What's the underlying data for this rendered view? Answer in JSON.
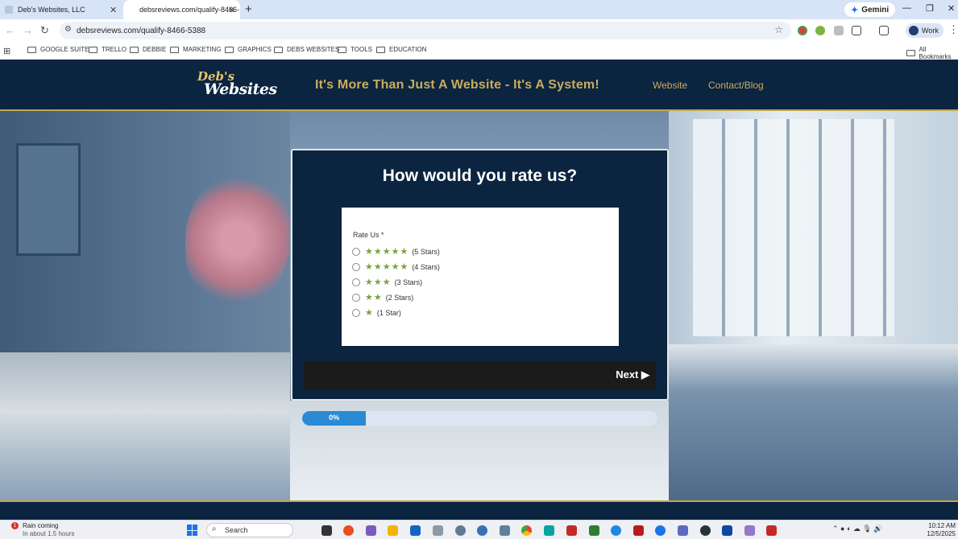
{
  "browser": {
    "tabs": [
      {
        "label": "Deb's Websites, LLC",
        "active": false
      },
      {
        "label": "debsreviews.com/qualify-8466-",
        "active": true
      }
    ],
    "gemini_label": "Gemini",
    "url": "debsreviews.com/qualify-8466-5388",
    "profile_label": "Work",
    "bookmarks": [
      "GOOGLE SUITE",
      "TRELLO",
      "DEBBIE",
      "MARKETING",
      "GRAPHICS",
      "DEBS WEBSITES",
      "TOOLS",
      "EDUCATION"
    ],
    "all_bookmarks_label": "All Bookmarks"
  },
  "site": {
    "logo_line1": "Deb's",
    "logo_line2": "Websites",
    "tagline": "It's More Than Just A Website - It's A System!",
    "nav": [
      "Website",
      "Contact/Blog"
    ]
  },
  "form": {
    "title": "How would you rate us?",
    "field_label": "Rate Us *",
    "options": [
      {
        "stars": "★★★★★",
        "label": "(5 Stars)"
      },
      {
        "stars": "★★★★★",
        "label": "(4 Stars)"
      },
      {
        "stars": "★★★",
        "label": "(3 Stars)"
      },
      {
        "stars": "★★",
        "label": "(2 Stars)"
      },
      {
        "stars": "★",
        "label": "(1 Star)"
      }
    ],
    "next_label": "Next ▶",
    "progress_text": "0%",
    "progress_fraction": 0.18
  },
  "taskbar": {
    "weather_badge": "1",
    "weather_title": "Rain coming",
    "weather_sub": "In about 1.5 hours",
    "search_label": "Search",
    "time": "10:12 AM",
    "date": "12/5/2025"
  },
  "colors": {
    "site_navy": "#0b2440",
    "site_gold": "#c9ad5e",
    "star_green": "#7aa33a",
    "progress_blue": "#2a8ad4"
  }
}
